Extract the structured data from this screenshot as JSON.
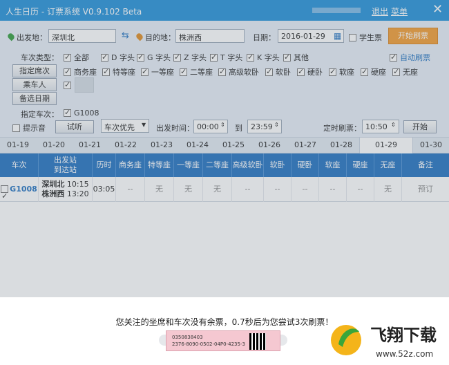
{
  "titlebar": {
    "title": "人生日历 - 订票系统 V0.9.102 Beta",
    "logout": "退出",
    "menu": "菜单",
    "close": "✕"
  },
  "form": {
    "from_label": "出发地：",
    "from_value": "深圳北",
    "to_label": "目的地：",
    "to_value": "株洲西",
    "date_label": "日期：",
    "date_value": "2016-01-29",
    "student_label": "学生票",
    "start_button": "开始刷票",
    "train_type_label": "车次类型：",
    "train_types": [
      "全部",
      "D 字头",
      "G 字头",
      "Z 字头",
      "T 字头",
      "K 字头",
      "其他"
    ],
    "auto_refresh": "自动刷票",
    "seat_button": "指定席次",
    "seats": [
      "商务座",
      "特等座",
      "一等座",
      "二等座",
      "高级软卧",
      "软卧",
      "硬卧",
      "软座",
      "硬座",
      "无座"
    ],
    "passenger_button": "乘车人",
    "backup_date_button": "备选日期",
    "train_label": "指定车次：",
    "train_value": "G1008",
    "tone_label": "提示音",
    "listen_button": "试听",
    "priority_select": "车次优先",
    "time_label": "出发时间：",
    "time_from": "00:00",
    "time_to_label": "到",
    "time_to": "23:59",
    "timer_label": "定时刷票：",
    "timer_value": "10:50",
    "timer_button": "开始"
  },
  "dates": [
    "01-19",
    "01-20",
    "01-21",
    "01-22",
    "01-23",
    "01-24",
    "01-25",
    "01-26",
    "01-27",
    "01-28",
    "01-29",
    "01-30"
  ],
  "table": {
    "headers": [
      "车次",
      "出发站\n到达站",
      "历时",
      "商务座",
      "特等座",
      "一等座",
      "二等座",
      "高级软卧",
      "软卧",
      "硬卧",
      "软座",
      "硬座",
      "无座",
      "备注"
    ],
    "row": {
      "train": "G1008",
      "from": "深圳北",
      "to": "株洲西",
      "dep": "10:15",
      "arr": "13:20",
      "duration": "03:05",
      "cells": [
        "--",
        "无",
        "无",
        "无",
        "--",
        "--",
        "--",
        "--",
        "--",
        "无",
        "--"
      ],
      "note": "预订"
    }
  },
  "status": {
    "message": "您关注的坐席和车次没有余票，0.7秒后为您尝试3次刷票！",
    "ticket_line1": "0350838403",
    "ticket_line2": "2376-8090-0502-04P0-4235-3"
  },
  "watermark": {
    "brand": "飞翔下载",
    "url": "www.52z.com"
  },
  "colors": {
    "titlebar": "#1f8fd8",
    "header": "#1e6fbf",
    "start_button": "#f39a2d"
  }
}
